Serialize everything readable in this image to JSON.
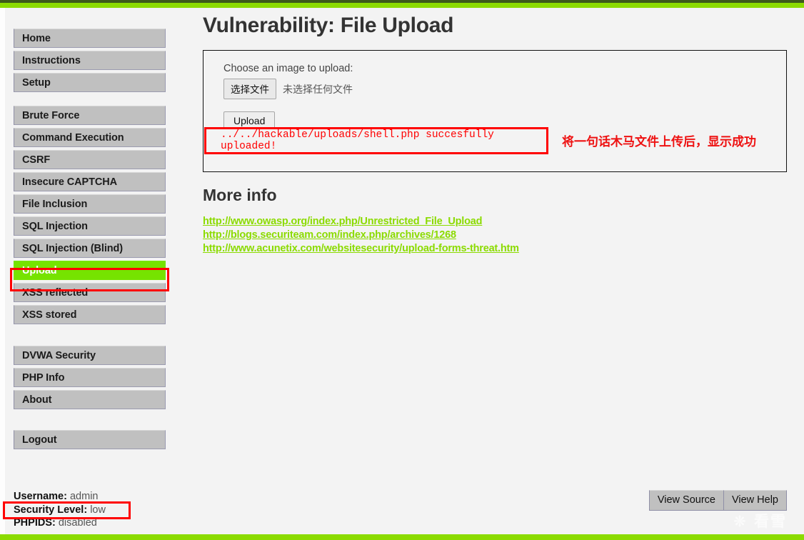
{
  "theme": {
    "bar_green": "#8bdb00",
    "bar_dark_green": "#3d5a1a",
    "active_nav": "#76e300",
    "annotation_red": "#ff0000",
    "link_green": "#8bdb00",
    "nav_button": "#c0c0c0"
  },
  "sidebar": {
    "groups": [
      {
        "items": [
          {
            "label": "Home",
            "active": false
          },
          {
            "label": "Instructions",
            "active": false
          },
          {
            "label": "Setup",
            "active": false
          }
        ]
      },
      {
        "items": [
          {
            "label": "Brute Force",
            "active": false
          },
          {
            "label": "Command Execution",
            "active": false
          },
          {
            "label": "CSRF",
            "active": false
          },
          {
            "label": "Insecure CAPTCHA",
            "active": false
          },
          {
            "label": "File Inclusion",
            "active": false
          },
          {
            "label": "SQL Injection",
            "active": false
          },
          {
            "label": "SQL Injection (Blind)",
            "active": false
          },
          {
            "label": "Upload",
            "active": true
          },
          {
            "label": "XSS reflected",
            "active": false
          },
          {
            "label": "XSS stored",
            "active": false
          }
        ]
      },
      {
        "items": [
          {
            "label": "DVWA Security",
            "active": false
          },
          {
            "label": "PHP Info",
            "active": false
          },
          {
            "label": "About",
            "active": false
          }
        ]
      },
      {
        "items": [
          {
            "label": "Logout",
            "active": false
          }
        ]
      }
    ]
  },
  "status": {
    "username_key": "Username:",
    "username_value": "admin",
    "security_key": "Security Level:",
    "security_value": "low",
    "phpids_key": "PHPIDS:",
    "phpids_value": "disabled"
  },
  "main": {
    "title": "Vulnerability: File Upload",
    "upload_panel": {
      "choose_label": "Choose an image to upload:",
      "file_button_label": "选择文件",
      "file_status_label": "未选择任何文件",
      "upload_button_label": "Upload",
      "success_message": "../../hackable/uploads/shell.php succesfully uploaded!"
    },
    "annotation_note": "将一句话木马文件上传后，显示成功",
    "more_info_title": "More info",
    "links": [
      "http://www.owasp.org/index.php/Unrestricted_File_Upload",
      "http://blogs.securiteam.com/index.php/archives/1268",
      "http://www.acunetix.com/websitesecurity/upload-forms-threat.htm"
    ]
  },
  "footer": {
    "view_source_label": "View Source",
    "view_help_label": "View Help",
    "watermark": "❋ 看雪"
  }
}
